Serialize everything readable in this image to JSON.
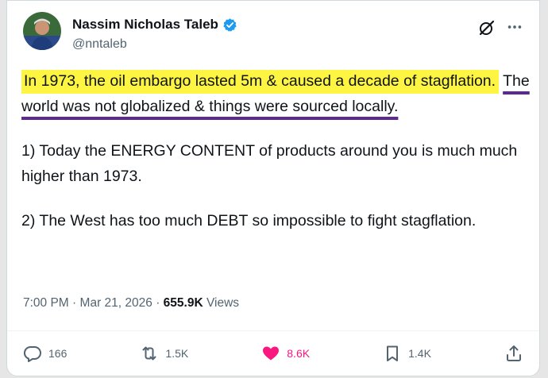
{
  "author": {
    "name": "Nassim Nicholas Taleb",
    "handle": "@nntaleb",
    "verified": true
  },
  "post": {
    "highlight_text": "In 1973, the oil embargo lasted 5m & caused a decade of stagflation.",
    "underlined_text": "The world was not globalized & things were sourced locally.",
    "paragraph_2": "1) Today the ENERGY CONTENT of products around you is much much higher than 1973.",
    "paragraph_3": "2) The West has too much DEBT so impossible to fight stagflation."
  },
  "meta": {
    "time": "7:00 PM",
    "separator": "·",
    "date": "Mar 21, 2026",
    "views_count": "655.9K",
    "views_label": "Views"
  },
  "actions": {
    "replies": "166",
    "reposts": "1.5K",
    "likes": "8.6K",
    "bookmarks": "1.4K"
  },
  "colors": {
    "highlight": "#fdf541",
    "underline": "#5b2a91",
    "verified": "#1d9bf0",
    "like": "#f91880"
  },
  "icons": [
    "grok-icon",
    "more-icon",
    "reply-icon",
    "repost-icon",
    "heart-icon",
    "bookmark-icon",
    "share-icon",
    "verified-badge-icon"
  ]
}
